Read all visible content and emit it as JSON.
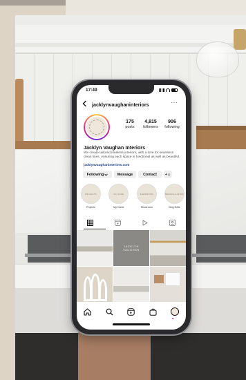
{
  "status_bar": {
    "time": "17:49"
  },
  "header": {
    "back_icon": "chevron-left-icon",
    "username": "jacklynvaughaninteriors",
    "more_icon": "more-horizontal-icon",
    "more_glyph": "···"
  },
  "profile": {
    "avatar_text": "JACKLYN VAUGHAN",
    "stats": [
      {
        "value": "175",
        "label": "posts"
      },
      {
        "value": "4,815",
        "label": "followers"
      },
      {
        "value": "906",
        "label": "following"
      }
    ],
    "name": "Jacklyn Vaughan Interiors",
    "bio": "We create tailored timeless interiors, with a love for seamless clean lines, ensuring each space is functional as well as beautiful.",
    "link": "jacklynvaughaninteriors.com"
  },
  "actions": {
    "following": "Following",
    "message": "Message",
    "contact": "Contact",
    "add_person_glyph": "+☺"
  },
  "highlights": [
    {
      "cover": "PROJECTS",
      "label": "Projects"
    },
    {
      "cover": "MY HOME",
      "label": "My Home"
    },
    {
      "cover": "SHOWROOM",
      "label": "Showroom"
    },
    {
      "cover": "BEFORE & AFTER",
      "label": "Blog Edits"
    }
  ],
  "tabs": [
    "grid-icon",
    "reels-icon",
    "play-icon",
    "tagged-icon"
  ],
  "grid": {
    "tile_text_line1": "JACKLYN",
    "tile_text_line2": "VAUGHAN"
  },
  "bottom_nav": [
    "home-icon",
    "search-icon",
    "reels-icon",
    "shop-icon",
    "profile-avatar"
  ],
  "colors": {
    "story_ring": "#ee2a7b",
    "link": "#1a3a7a",
    "button_bg": "#efefef"
  }
}
